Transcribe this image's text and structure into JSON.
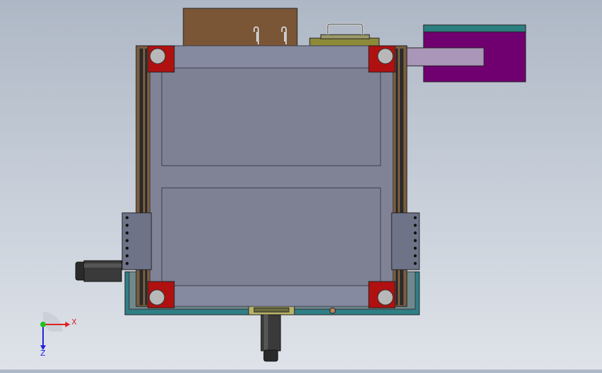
{
  "colors": {
    "background_top": "#aeb7c5",
    "background_bottom": "#dfe3e9",
    "frame_brown": "#7a5c3e",
    "frame_dark": "#2b2b2b",
    "panel": "#808396",
    "panel_edge": "#3b3e4a",
    "corner_red": "#b01010",
    "wheel": "#b8b8b8",
    "box_brown": "#7a5636",
    "box_olive": "#8d8a3a",
    "motor_purple": "#700070",
    "motor_teal": "#2c7f7f",
    "shaft": "#a996b8",
    "bracket": "#6f7388",
    "base_teal": "#2f7f86",
    "axis_x": "#e02020",
    "axis_y": "#20c020",
    "axis_z": "#2020e0"
  },
  "triad": {
    "x_label": "X",
    "z_label": "Z"
  },
  "icons": {
    "triad": "coordinate-triad-icon"
  }
}
